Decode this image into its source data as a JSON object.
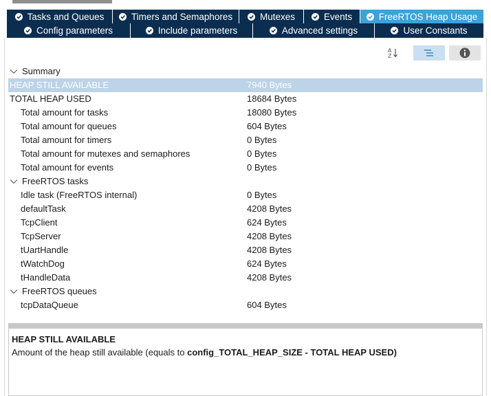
{
  "tabs_row1": [
    {
      "label": "Tasks and Queues"
    },
    {
      "label": "Timers and Semaphores"
    },
    {
      "label": "Mutexes"
    },
    {
      "label": "Events"
    },
    {
      "label": "FreeRTOS Heap Usage"
    }
  ],
  "tabs_row2": [
    {
      "label": "Config parameters"
    },
    {
      "label": "Include parameters"
    },
    {
      "label": "Advanced settings"
    },
    {
      "label": "User Constants"
    }
  ],
  "summary": {
    "label": "Summary",
    "rows": [
      {
        "name": "HEAP STILL AVAILABLE",
        "value": "7940  Bytes"
      },
      {
        "name": "TOTAL HEAP USED",
        "value": "18684  Bytes"
      },
      {
        "name": "Total amount for tasks",
        "value": "18080  Bytes"
      },
      {
        "name": "Total amount for queues",
        "value": "604  Bytes"
      },
      {
        "name": "Total amount for timers",
        "value": "0  Bytes"
      },
      {
        "name": "Total amount for mutexes and semaphores",
        "value": "0  Bytes"
      },
      {
        "name": "Total amount for events",
        "value": "0  Bytes"
      }
    ]
  },
  "tasks": {
    "label": "FreeRTOS tasks",
    "rows": [
      {
        "name": "Idle task (FreeRTOS internal)",
        "value": "0  Bytes"
      },
      {
        "name": "defaultTask",
        "value": "4208  Bytes"
      },
      {
        "name": "TcpClient",
        "value": "624  Bytes"
      },
      {
        "name": "TcpServer",
        "value": "4208  Bytes"
      },
      {
        "name": "tUartHandle",
        "value": "4208  Bytes"
      },
      {
        "name": "tWatchDog",
        "value": "624  Bytes"
      },
      {
        "name": "tHandleData",
        "value": "4208  Bytes"
      }
    ]
  },
  "queues": {
    "label": "FreeRTOS queues",
    "rows": [
      {
        "name": "tcpDataQueue",
        "value": "604  Bytes"
      }
    ]
  },
  "description": {
    "title": "HEAP STILL AVAILABLE",
    "text_prefix": "Amount of the heap still available (equals to ",
    "text_bold": "config_TOTAL_HEAP_SIZE - TOTAL HEAP USED)"
  },
  "colors": {
    "tab_bg": "#0b2d4f",
    "tab_active": "#3ea1d8",
    "selected_row": "#bcd3e8"
  },
  "icons": [
    "check-circle-icon",
    "sort-az-icon",
    "list-icon",
    "info-icon",
    "chevron-down-icon"
  ]
}
